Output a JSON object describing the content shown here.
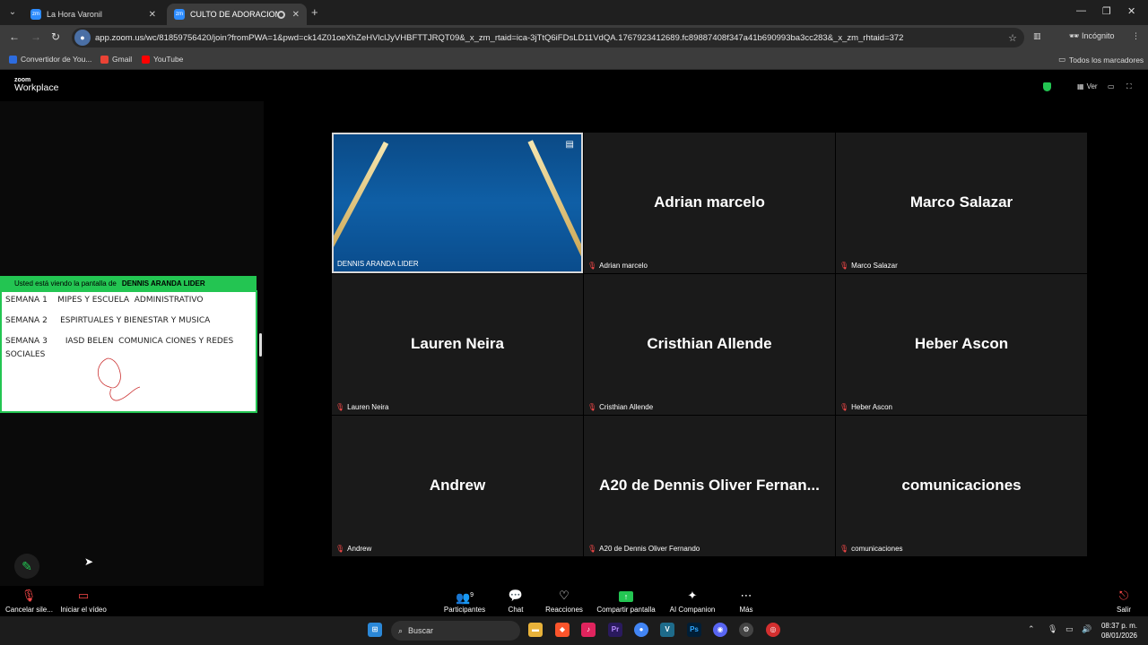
{
  "browser": {
    "tabs": [
      {
        "title": "La Hora Varonil"
      },
      {
        "title": "CULTO DE ADORACION"
      }
    ],
    "url": "app.zoom.us/wc/81859756420/join?fromPWA=1&pwd=ck14Z01oeXhZeHVlclJyVHBFTTJRQT09&_x_zm_rtaid=ica-3jTtQ6iFDsLD11VdQA.1767923412689.fc89887408f347a41b690993ba3cc283&_x_zm_rhtaid=372",
    "profile": "Incógnito",
    "bookmarks": [
      "Convertidor de You...",
      "Gmail",
      "YouTube"
    ],
    "all_bookmarks": "Todos los marcadores"
  },
  "zoom": {
    "logo_top": "zoom",
    "logo_bottom": "Workplace",
    "view_label": "Ver",
    "accent": "#23c552",
    "share_banner_prefix": "Usted está viendo la pantalla de",
    "share_banner_name": "DENNIS ARANDA LIDER",
    "share_lines": [
      "SEMANA 1    MIPES Y ESCUELA  ADMINISTRATIVO",
      "SEMANA 2     ESPIRTUALES Y BIENESTAR Y MUSICA",
      "SEMANA 3       IASD BELEN  COMUNICA CIONES Y REDES",
      "SOCIALES"
    ],
    "participants": [
      {
        "display": "",
        "label": "DENNIS ARANDA LIDER",
        "muted": false,
        "video": true
      },
      {
        "display": "Adrian marcelo",
        "label": "Adrian marcelo",
        "muted": true
      },
      {
        "display": "Marco Salazar",
        "label": "Marco Salazar",
        "muted": true
      },
      {
        "display": "Lauren Neira",
        "label": "Lauren Neira",
        "muted": true
      },
      {
        "display": "Cristhian Allende",
        "label": "Cristhian Allende",
        "muted": true
      },
      {
        "display": "Heber Ascon",
        "label": "Heber Ascon",
        "muted": true
      },
      {
        "display": "Andrew",
        "label": "Andrew",
        "muted": true
      },
      {
        "display": "A20 de Dennis Oliver Fernan...",
        "label": "A20 de Dennis Oliver Fernando",
        "muted": true
      },
      {
        "display": "comunicaciones",
        "label": "comunicaciones",
        "muted": true
      }
    ],
    "controls": {
      "audio": "Cancelar sile...",
      "video": "Iniciar el vídeo",
      "participants": "Participantes",
      "participants_count": "9",
      "chat": "Chat",
      "reactions": "Reacciones",
      "share": "Compartir pantalla",
      "ai": "AI Companion",
      "more": "Más",
      "leave": "Salir"
    }
  },
  "taskbar": {
    "search": "Buscar",
    "time": "08:37 p. m.",
    "date": "08/01/2026"
  }
}
